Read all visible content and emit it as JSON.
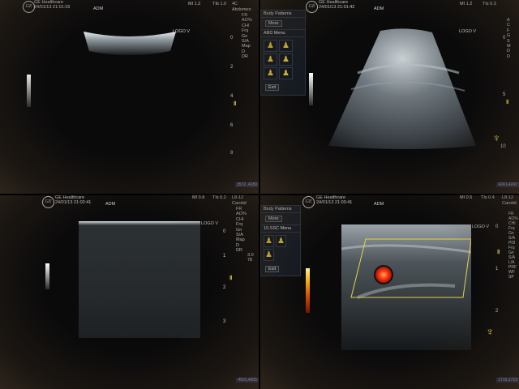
{
  "panel1": {
    "brand": "GE Healthcare",
    "datetime": "24/01/13 21:01:15",
    "operator": "ADM",
    "mi": "MI 1.2",
    "tib": "TIb 1.0",
    "probe": "4C",
    "preset": "Abdomen",
    "params": [
      "FR",
      "AO%",
      "",
      "CHI",
      "Frq",
      "Gn",
      "S/A",
      "Map",
      "D",
      "DR"
    ],
    "depth_marks": [
      "0",
      "2",
      "4",
      "6",
      "8"
    ],
    "orientation": "LOGO V",
    "status": "3572 ,4189"
  },
  "panel2": {
    "brand": "GE Healthcare",
    "datetime": "24/01/13 21:01:42",
    "operator": "ADM",
    "mi": "MI 1.2",
    "tib": "TIs 0.3",
    "menu_title": "Body Patterns",
    "more_button": "More",
    "submenu": "ABD Menu",
    "exit_button": "Exit",
    "params": [
      "A",
      "C",
      "F",
      "G",
      "S",
      "M",
      "D",
      "D"
    ],
    "depth_marks": [
      "0",
      "5",
      "10"
    ],
    "orientation": "LOGO V",
    "status": "4241,4247"
  },
  "panel3": {
    "brand": "GE Healthcare",
    "datetime": "24/01/13 21:02:41",
    "operator": "ADM",
    "mi": "MI 0.8",
    "tib": "TIs 0.2",
    "probe": "L8-12",
    "preset": "Carotid",
    "params": [
      "FR",
      "AO%",
      "",
      "CHI",
      "Frq",
      "Gn",
      "S/A",
      "Map",
      "D",
      "DR"
    ],
    "param_values": [
      "",
      "",
      "",
      "",
      "",
      "",
      "",
      "",
      "3.0",
      "78"
    ],
    "depth_marks": [
      "0",
      "1",
      "2",
      "3"
    ],
    "orientation": "LOGO V",
    "status": "4501,4505"
  },
  "panel4": {
    "brand": "GE Healthcare",
    "datetime": "24/01/13 21:03:41",
    "operator": "ADM",
    "mi": "MI 0.5",
    "tib": "TIs 0.4",
    "probe": "L8-12",
    "preset": "Carotid",
    "menu_title": "Body Patterns",
    "more_button": "More",
    "submenu": "10.SSC Menu",
    "exit_button": "Exit",
    "params": [
      "FR",
      "AO%",
      "",
      "CHI",
      "Frq",
      "Gn",
      "S/A",
      "",
      "PDI",
      "Frq",
      "Gn",
      "S/A",
      "L/A",
      "PRF",
      "WF",
      "SP"
    ],
    "depth_marks": [
      "0",
      "1",
      "2"
    ],
    "orientation": "LOGO V",
    "status": "1715,1715"
  },
  "colors": {
    "accent": "#e6d34a",
    "doppler": "#ff3a1a",
    "menu_bg": "#141a22"
  }
}
